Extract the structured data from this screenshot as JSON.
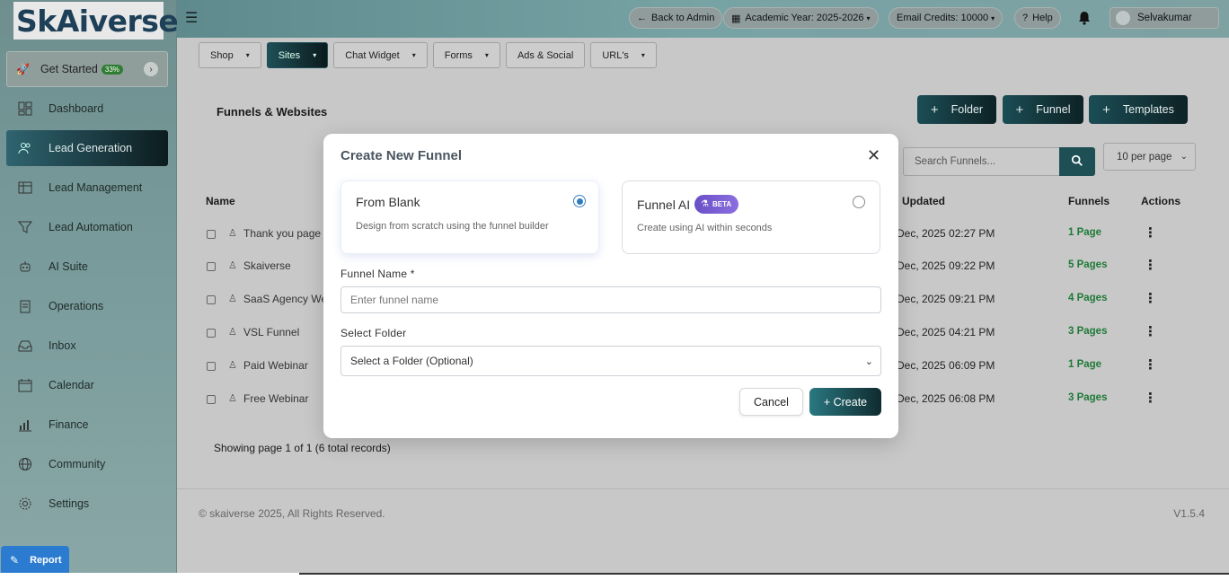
{
  "sidebar": {
    "logo": "SkAiverse",
    "get_started": {
      "label": "Get Started",
      "badge": "33%"
    },
    "items": [
      {
        "label": "Dashboard",
        "icon": "dashboard-icon"
      },
      {
        "label": "Lead Generation",
        "icon": "users-icon",
        "active": true
      },
      {
        "label": "Lead Management",
        "icon": "table-icon"
      },
      {
        "label": "Lead Automation",
        "icon": "funnel-icon"
      },
      {
        "label": "AI Suite",
        "icon": "robot-icon"
      },
      {
        "label": "Operations",
        "icon": "clipboard-icon"
      },
      {
        "label": "Inbox",
        "icon": "inbox-icon"
      },
      {
        "label": "Calendar",
        "icon": "calendar-icon"
      },
      {
        "label": "Finance",
        "icon": "chart-icon"
      },
      {
        "label": "Community",
        "icon": "globe-icon"
      },
      {
        "label": "Settings",
        "icon": "gear-icon"
      }
    ],
    "report": "Report"
  },
  "topbar": {
    "back": "Back to Admin",
    "academic_year": "Academic Year: 2025-2026",
    "email_credits": "Email Credits: 10000",
    "help": "Help",
    "user": "Selvakumar"
  },
  "tabs": [
    {
      "label": "Shop",
      "dropdown": true
    },
    {
      "label": "Sites",
      "dropdown": true,
      "active": true
    },
    {
      "label": "Chat Widget",
      "dropdown": true
    },
    {
      "label": "Forms",
      "dropdown": true
    },
    {
      "label": "Ads & Social",
      "dropdown": false
    },
    {
      "label": "URL's",
      "dropdown": true
    }
  ],
  "page": {
    "title": "Funnels & Websites",
    "buttons": {
      "folder": "Folder",
      "funnel": "Funnel",
      "templates": "Templates"
    },
    "search_placeholder": "Search Funnels...",
    "per_page": "10 per page",
    "columns": {
      "name": "Name",
      "updated": "Updated",
      "funnels": "Funnels",
      "actions": "Actions"
    },
    "rows": [
      {
        "name": "Thank you page",
        "updated": "Dec, 2025 02:27 PM",
        "pages": "1 Page"
      },
      {
        "name": "Skaiverse",
        "updated": "Dec, 2025 09:22 PM",
        "pages": "5 Pages"
      },
      {
        "name": "SaaS Agency We",
        "updated": "Dec, 2025 09:21 PM",
        "pages": "4 Pages"
      },
      {
        "name": "VSL Funnel",
        "updated": "Dec, 2025 04:21 PM",
        "pages": "3 Pages"
      },
      {
        "name": "Paid Webinar",
        "updated": "Dec, 2025 06:09 PM",
        "pages": "1 Page"
      },
      {
        "name": "Free Webinar",
        "updated": "Dec, 2025 06:08 PM",
        "pages": "3 Pages"
      }
    ],
    "pager": "Showing page 1 of 1 (6 total records)"
  },
  "footer": {
    "copyright": "© skaiverse 2025, All Rights Reserved.",
    "version": "V1.5.4"
  },
  "modal": {
    "title": "Create New Funnel",
    "option_blank": {
      "title": "From Blank",
      "desc": "Design from scratch using the funnel builder"
    },
    "option_ai": {
      "title": "Funnel AI",
      "badge": "BETA",
      "desc": "Create using AI within seconds"
    },
    "name_label": "Funnel Name *",
    "name_placeholder": "Enter funnel name",
    "folder_label": "Select Folder",
    "folder_value": "Select a Folder (Optional)",
    "cancel": "Cancel",
    "create": "+ Create"
  }
}
